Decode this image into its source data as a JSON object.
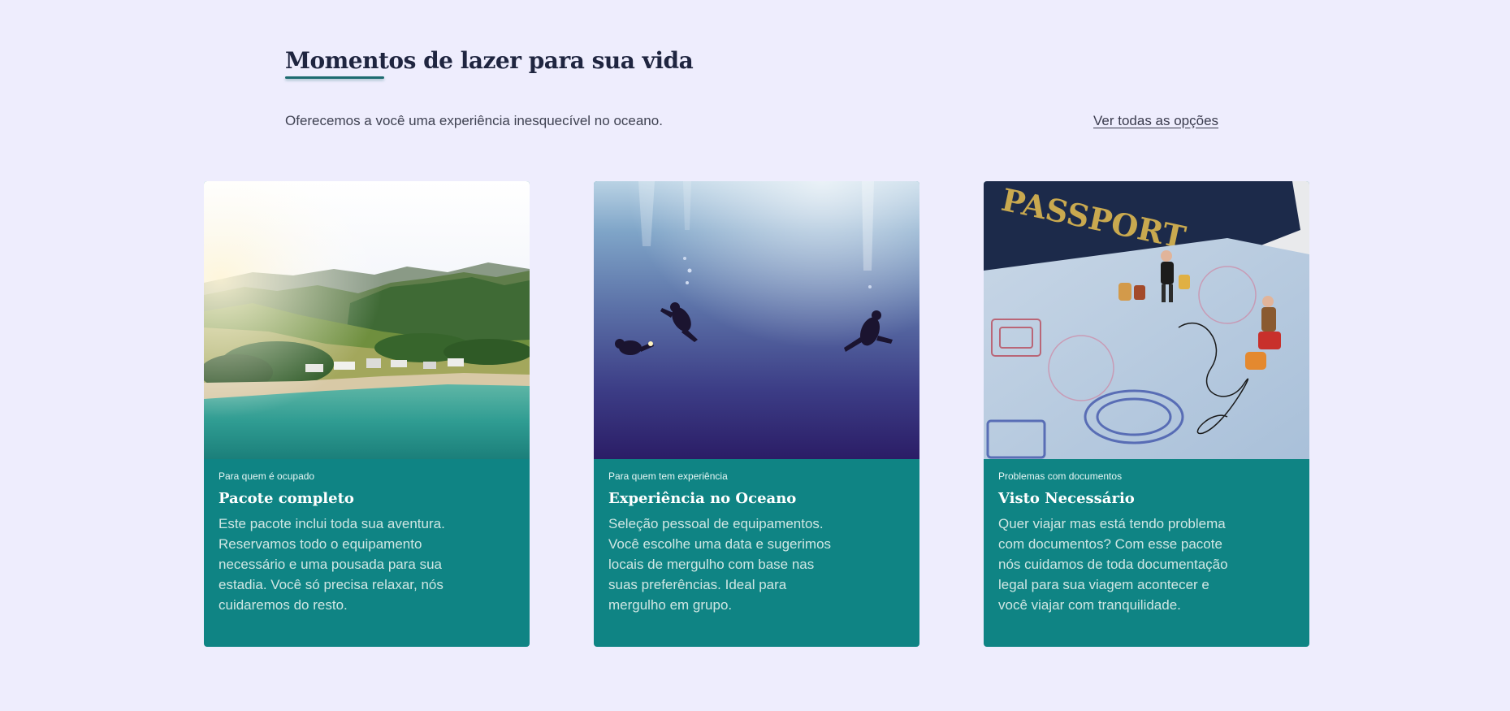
{
  "header": {
    "title": "Momentos de lazer para sua vida",
    "subtitle": "Oferecemos a você uma experiência inesquecível no oceano.",
    "see_all_link": "Ver todas as opções"
  },
  "cards": [
    {
      "eyebrow": "Para quem é ocupado",
      "title": "Pacote completo",
      "description": "Este pacote inclui toda sua aventura. Reservamos todo o equipamento necessário e uma pousada para sua estadia. Você só precisa relaxar, nós cuidaremos do resto.",
      "image": "beach-village-photo"
    },
    {
      "eyebrow": "Para quem tem experiência",
      "title": "Experiência no Oceano",
      "description": "Seleção pessoal de equipamentos. Você escolhe uma data e sugerimos locais de mergulho com base nas suas preferências. Ideal para mergulho em grupo.",
      "image": "scuba-divers-photo"
    },
    {
      "eyebrow": "Problemas com documentos",
      "title": "Visto Necessário",
      "description": "Quer viajar mas está tendo problema com documentos? Com esse pacote nós cuidamos de toda documentação legal para sua viagem acontecer e você viajar com tranquilidade.",
      "image": "passport-photo",
      "image_text": "PASSPORT"
    }
  ],
  "colors": {
    "background": "#eeedfd",
    "card": "#0f8484",
    "title": "#1f2540",
    "accent_underline": "#1e6b70"
  }
}
